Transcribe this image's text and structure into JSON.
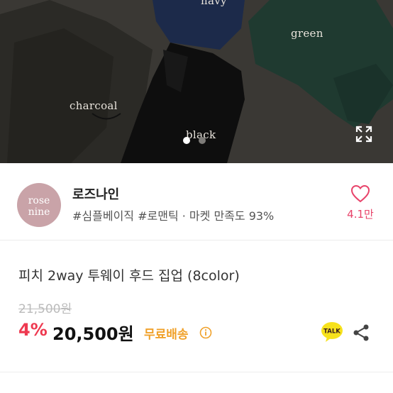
{
  "hero": {
    "labels": {
      "navy": "navy",
      "green": "green",
      "charcoal": "charcoal",
      "black": "black"
    },
    "carousel": {
      "current": 1,
      "total": 2
    },
    "expand_icon": "expand-icon"
  },
  "seller": {
    "avatar_line1": "rose",
    "avatar_line2": "nine",
    "name": "로즈나인",
    "tags": "#심플베이직 #로맨틱 · 마켓 만족도 93%",
    "likes": "4.1만",
    "heart_icon": "heart-icon"
  },
  "product": {
    "title": "피치 2way 투웨이 후드 집업 (8color)",
    "original_price": "21,500원",
    "discount": "4%",
    "price": "20,500원",
    "shipping": "무료배송",
    "talk_label": "TALK"
  },
  "colors": {
    "accent_pink": "#e8436a",
    "discount_red": "#ee3950",
    "shipping_orange": "#f0a12a",
    "avatar_bg": "#c9a3a8",
    "talk_yellow": "#f7e21d"
  }
}
